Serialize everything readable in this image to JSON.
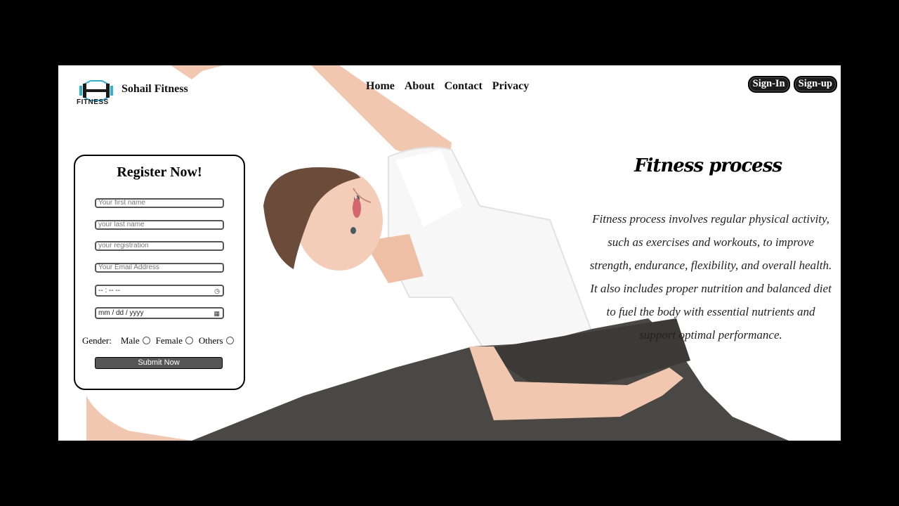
{
  "brand": {
    "logo_word": "FITNESS",
    "name": "Sohail Fitness",
    "logo_icon": "dumbbell-icon",
    "accent": "#2cb3d6"
  },
  "nav": {
    "items": [
      "Home",
      "About",
      "Contact",
      "Privacy"
    ]
  },
  "auth": {
    "signin": "Sign-In",
    "signup": "Sign-up"
  },
  "register": {
    "title": "Register Now!",
    "first_name_placeholder": "Your first name",
    "last_name_placeholder": "your last name",
    "registration_placeholder": "your registration",
    "email_placeholder": "Your Email Address",
    "time_value": "-- : --  --",
    "date_value": "mm / dd / yyyy",
    "time_icon": "clock-icon",
    "date_icon": "calendar-icon",
    "gender_label": "Gender:",
    "gender_options": [
      "Male",
      "Female",
      "Others"
    ],
    "submit_label": "Submit Now"
  },
  "fitness": {
    "title": "Fitness process",
    "body": "Fitness process involves regular physical activity, such as exercises and workouts, to improve strength, endurance, flexibility, and overall health. It also includes proper nutrition and balanced diet to fuel the body with essential nutrients and support optimal performance."
  },
  "colors": {
    "background": "#000000",
    "page": "#ffffff",
    "button_dark": "#1b1b1b",
    "submit": "#555555"
  }
}
